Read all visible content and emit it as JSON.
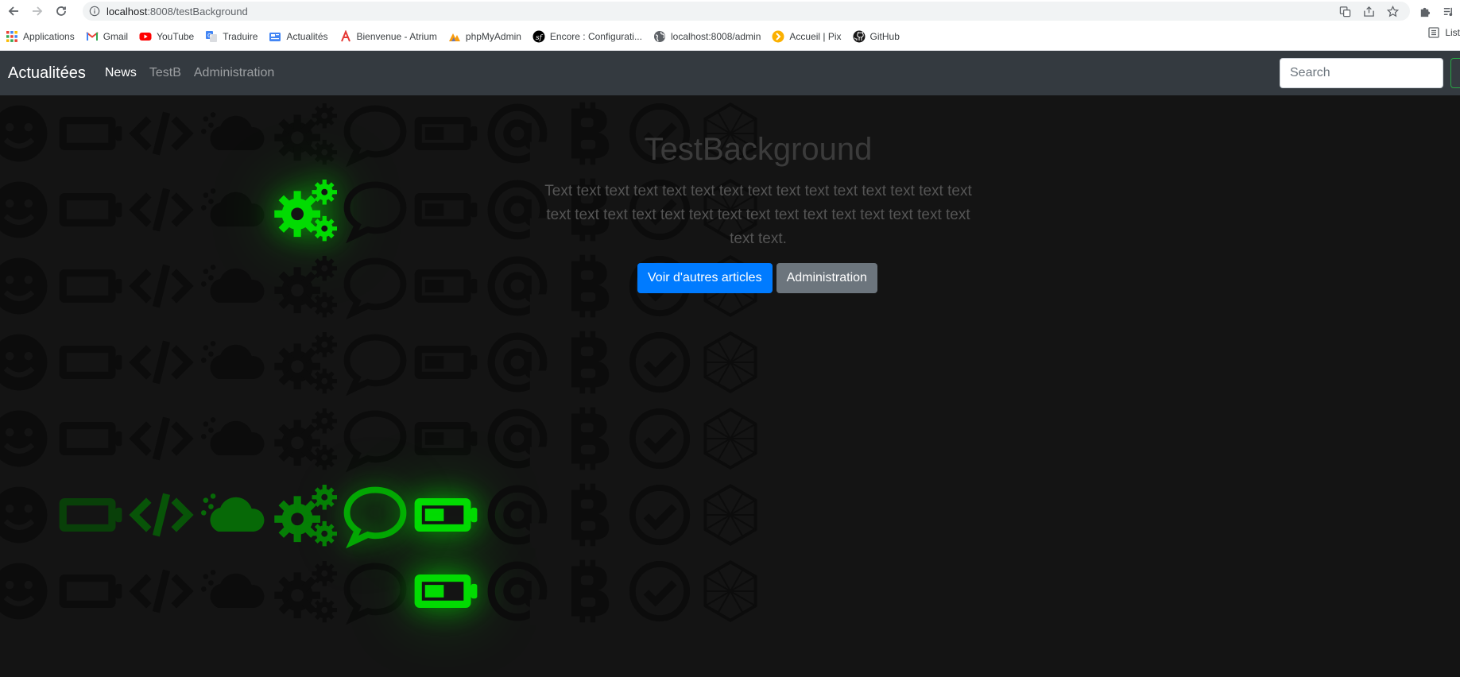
{
  "browser": {
    "url_host": "localhost",
    "url_rest": ":8008/testBackground",
    "bookmarks": [
      {
        "label": "Applications",
        "icon": "apps-grid-icon"
      },
      {
        "label": "Gmail",
        "icon": "gmail-icon"
      },
      {
        "label": "YouTube",
        "icon": "youtube-icon"
      },
      {
        "label": "Traduire",
        "icon": "translate-icon"
      },
      {
        "label": "Actualités",
        "icon": "news-icon"
      },
      {
        "label": "Bienvenue - Atrium",
        "icon": "atrium-icon"
      },
      {
        "label": "phpMyAdmin",
        "icon": "phpmyadmin-icon"
      },
      {
        "label": "Encore : Configurati...",
        "icon": "symfony-icon"
      },
      {
        "label": "localhost:8008/admin",
        "icon": "globe-icon"
      },
      {
        "label": "Accueil | Pix",
        "icon": "pix-icon"
      },
      {
        "label": "GitHub",
        "icon": "github-icon"
      }
    ],
    "reading_list": "List"
  },
  "navbar": {
    "brand": "Actualitées",
    "links": [
      {
        "label": "News",
        "active": true
      },
      {
        "label": "TestB",
        "active": false
      },
      {
        "label": "Administration",
        "active": false
      }
    ],
    "search_placeholder": "Search"
  },
  "hero": {
    "title": "TestBackground",
    "text": "Text text text text text text text text text text text text text text text text text text text text text text text text text text text text text text text text.",
    "primary_button": "Voir d'autres articles",
    "secondary_button": "Administration"
  },
  "background": {
    "columns": [
      "smiley-icon",
      "battery-icon",
      "code-icon",
      "cloud-icon",
      "gears-icon",
      "chat-bubble-icon",
      "battery-half-icon",
      "at-sign-icon",
      "bitcoin-icon",
      "check-circle-icon",
      "hexagon-icon"
    ],
    "row_count": 8,
    "glow_color": "#00ff00",
    "dim_color": "#0c0c0c",
    "highlights": [
      {
        "row": 2,
        "col": 4,
        "level": 1.0
      },
      {
        "row": 6,
        "col": 1,
        "level": 0.25
      },
      {
        "row": 6,
        "col": 2,
        "level": 0.35
      },
      {
        "row": 6,
        "col": 3,
        "level": 0.45
      },
      {
        "row": 6,
        "col": 4,
        "level": 0.55
      },
      {
        "row": 6,
        "col": 5,
        "level": 0.75
      },
      {
        "row": 6,
        "col": 6,
        "level": 1.0
      },
      {
        "row": 7,
        "col": 6,
        "level": 1.0
      }
    ]
  }
}
